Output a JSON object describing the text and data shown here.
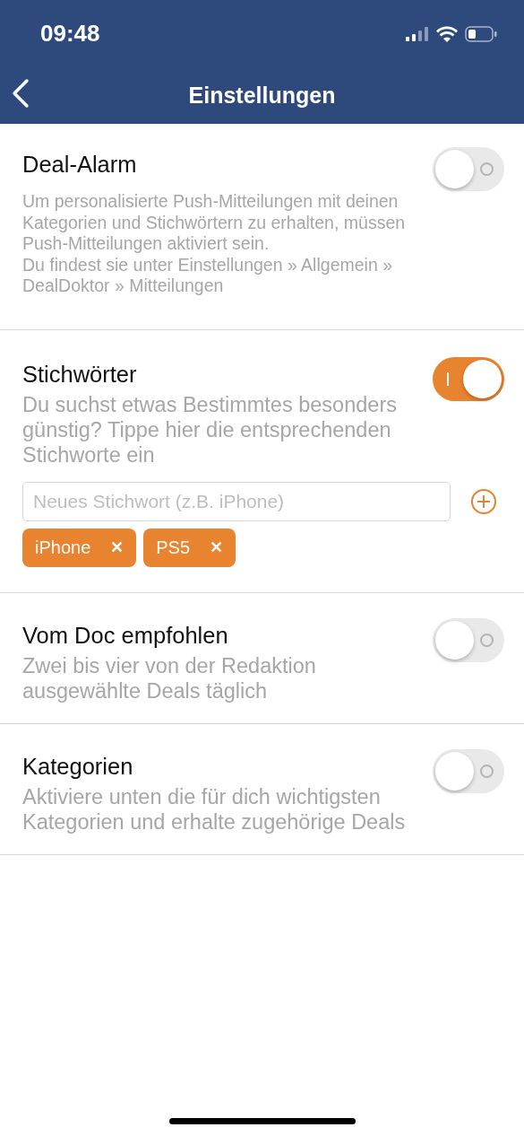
{
  "status_bar": {
    "time": "09:48"
  },
  "nav": {
    "title": "Einstellungen"
  },
  "sections": [
    {
      "title": "Deal-Alarm",
      "on": false,
      "small": true,
      "paragraphs": [
        "Um personalisierte Push-Mitteilungen mit deinen Kategorien und Stichwörtern zu erhalten, müssen Push-Mitteilungen aktiviert sein.",
        "Du findest sie unter Einstellungen » Allgemein » DealDoktor » Mitteilungen"
      ]
    },
    {
      "title": "Stichwörter",
      "on": true,
      "small": false,
      "paragraphs": [
        "Du suchst etwas Bestimmtes besonders günstig? Tippe hier die entsprechenden Stichworte ein"
      ],
      "input": {
        "placeholder": "Neues Stichwort (z.B. iPhone)"
      },
      "tags": [
        {
          "label": "iPhone",
          "remove": "✕"
        },
        {
          "label": "PS5",
          "remove": "✕"
        }
      ]
    },
    {
      "title": "Vom Doc empfohlen",
      "on": false,
      "small": false,
      "paragraphs": [
        "Zwei bis vier von der Redaktion ausgewählte Deals täglich"
      ]
    },
    {
      "title": "Kategorien",
      "on": false,
      "small": false,
      "paragraphs": [
        "Aktiviere unten die für dich wichtigsten Kategorien und erhalte zugehörige Deals"
      ]
    }
  ]
}
